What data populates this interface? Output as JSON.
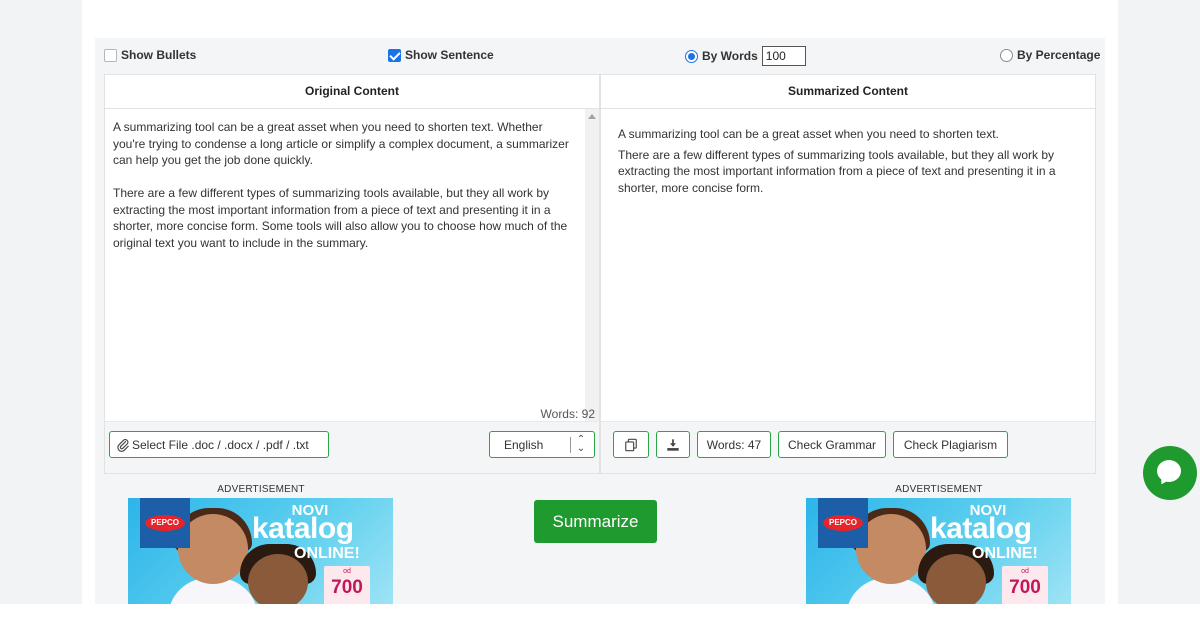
{
  "options": {
    "show_bullets": {
      "label": "Show Bullets",
      "checked": false
    },
    "show_sentence": {
      "label": "Show Sentence",
      "checked": true
    },
    "by_words": {
      "label": "By Words",
      "value": "100",
      "selected": true
    },
    "by_percentage": {
      "label": "By Percentage",
      "selected": false
    }
  },
  "original": {
    "title": "Original Content",
    "paragraphs": [
      "A summarizing tool can be a great asset when you need to shorten text. Whether you're trying to condense a long article or simplify a complex document, a summarizer can help you get the job done quickly.",
      "There are a few different types of summarizing tools available, but they all work by extracting the most important information from a piece of text and presenting it in a shorter, more concise form. Some tools will also allow you to choose how much of the original text you want to include in the summary."
    ],
    "word_count": "Words: 92",
    "select_file": "Select File .doc / .docx / .pdf / .txt",
    "language": "English"
  },
  "summarized": {
    "title": "Summarized Content",
    "paragraphs": [
      "A summarizing tool can be a great asset when you need to shorten text.",
      "There are a few different types of summarizing tools available, but they all work by extracting the most important information from a piece of text and presenting it in a shorter, more concise form."
    ],
    "word_count": "Words: 47",
    "check_grammar": "Check Grammar",
    "check_plagiarism": "Check Plagiarism"
  },
  "summarize_button": "Summarize",
  "ads": {
    "label": "ADVERTISEMENT",
    "brand": "PEPCO",
    "line1": "NOVI",
    "line2": "katalog",
    "line3": "ONLINE!",
    "price_prefix": "od",
    "price": "700"
  },
  "colors": {
    "accent_green": "#1e9a2e",
    "checkbox_blue": "#1a73e8"
  },
  "icons": {
    "attach": "paperclip-icon",
    "copy": "copy-icon",
    "download": "download-icon",
    "chat": "chat-icon"
  }
}
